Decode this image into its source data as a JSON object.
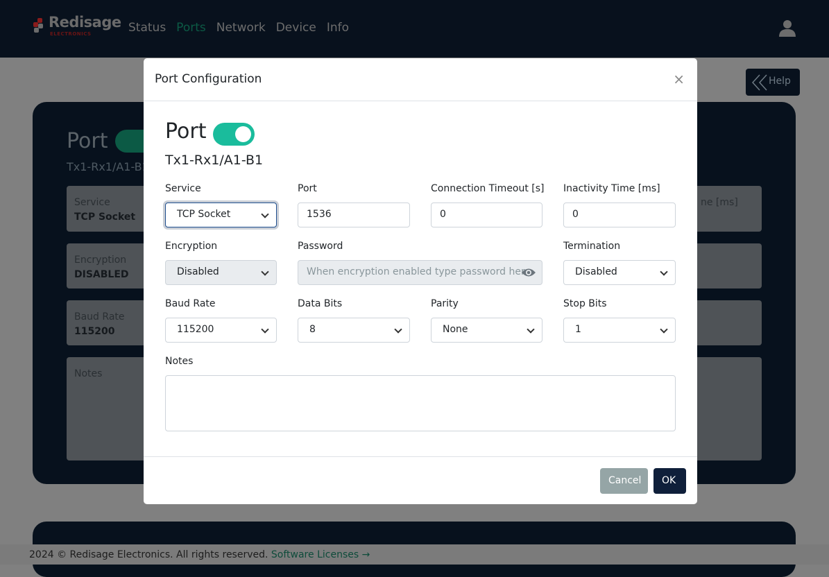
{
  "brand": {
    "name": "Redisage",
    "tagline": "ELECTRONICS"
  },
  "nav": {
    "items": [
      "Status",
      "Ports",
      "Network",
      "Device",
      "Info"
    ],
    "active": "Ports"
  },
  "help_label": "Help",
  "background": {
    "title": "Port",
    "subtitle": "Tx1-Rx1/A1-B1",
    "cards": [
      {
        "label": "Service",
        "value": "TCP Socket"
      },
      {
        "label": "Encryption",
        "value": "DISABLED"
      },
      {
        "label": "Baud Rate",
        "value": "115200"
      },
      {
        "label": "Notes",
        "value": ""
      }
    ],
    "right_partial_label": "ne [ms]"
  },
  "footer": {
    "text": "2024 © Redisage Electronics. All rights reserved.",
    "link": "Software Licenses →"
  },
  "modal": {
    "title": "Port Configuration",
    "close": "×",
    "heading": "Port",
    "enabled": true,
    "subtitle": "Tx1-Rx1/A1-B1",
    "fields": {
      "service": {
        "label": "Service",
        "value": "TCP Socket"
      },
      "port": {
        "label": "Port",
        "value": "1536"
      },
      "conn_timeout": {
        "label": "Connection Timeout [s]",
        "value": "0"
      },
      "inactivity": {
        "label": "Inactivity Time [ms]",
        "value": "0"
      },
      "encryption": {
        "label": "Encryption",
        "value": "Disabled"
      },
      "password": {
        "label": "Password",
        "placeholder": "When encryption enabled type password here"
      },
      "termination": {
        "label": "Termination",
        "value": "Disabled"
      },
      "baud": {
        "label": "Baud Rate",
        "value": "115200"
      },
      "data_bits": {
        "label": "Data Bits",
        "value": "8"
      },
      "parity": {
        "label": "Parity",
        "value": "None"
      },
      "stop_bits": {
        "label": "Stop Bits",
        "value": "1"
      },
      "notes": {
        "label": "Notes",
        "value": ""
      }
    },
    "cancel": "Cancel",
    "ok": "OK"
  },
  "colors": {
    "accent": "#1abc9c",
    "primary": "#0f1f3a",
    "cancel": "#95a5a6"
  }
}
